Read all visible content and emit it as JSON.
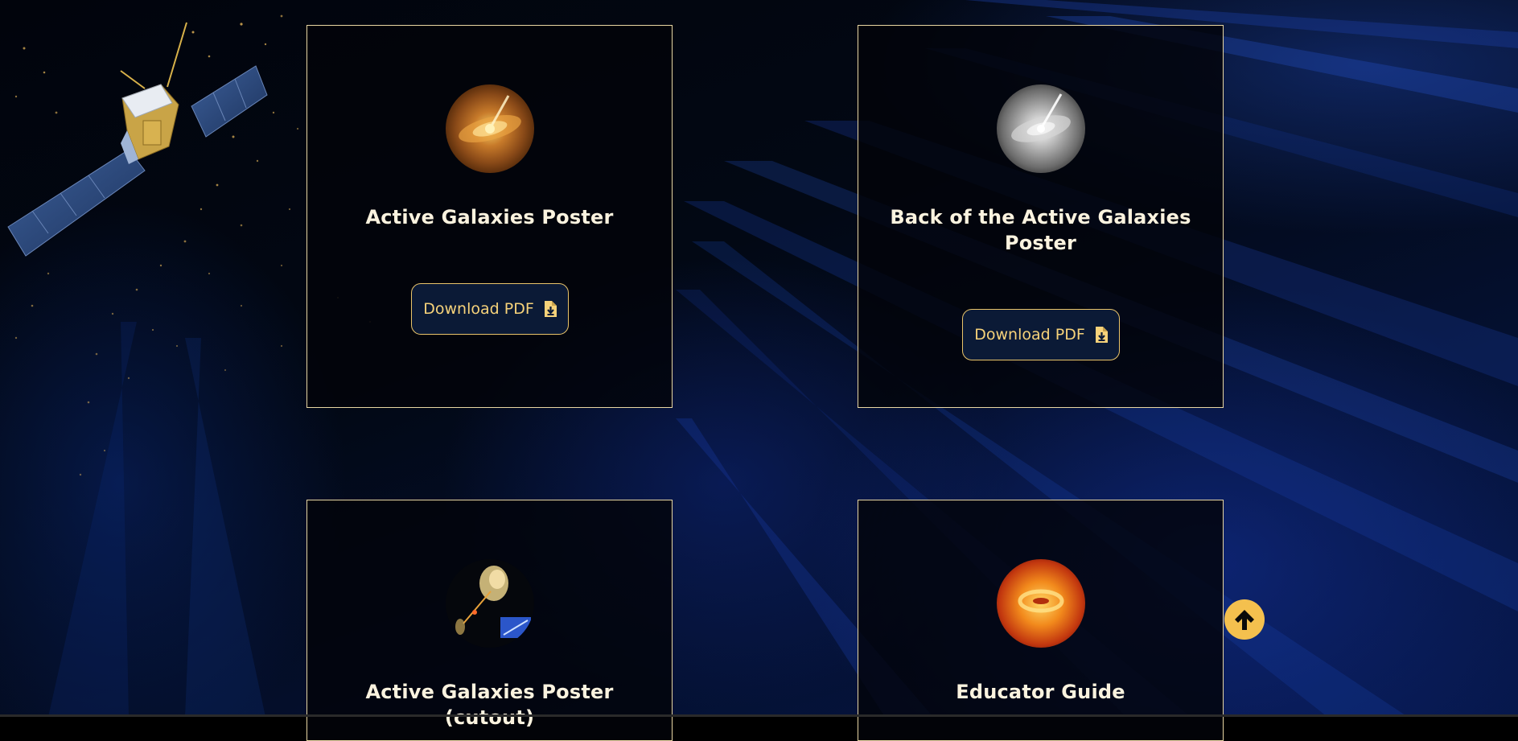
{
  "cards": [
    {
      "title": "Active Galaxies Poster",
      "button_label": "Download PDF",
      "icon": "pdf-download-icon",
      "thumb": "active-galaxy-color-thumbnail"
    },
    {
      "title": "Back of the Active Galaxies Poster",
      "button_label": "Download PDF",
      "icon": "pdf-download-icon",
      "thumb": "active-galaxy-grayscale-thumbnail"
    },
    {
      "title": "Active Galaxies Poster (cutout)",
      "thumb": "galaxy-jet-cutout-thumbnail"
    },
    {
      "title": "Educator Guide",
      "thumb": "galaxy-disk-orange-thumbnail"
    }
  ],
  "scroll_top": {
    "icon": "arrow-up-icon"
  },
  "colors": {
    "accent": "#f4c04e",
    "card_border": "#e9d7a3",
    "button_bg": "#0b1a36",
    "button_text": "#f6d27a",
    "title_text": "#fbf3df"
  }
}
